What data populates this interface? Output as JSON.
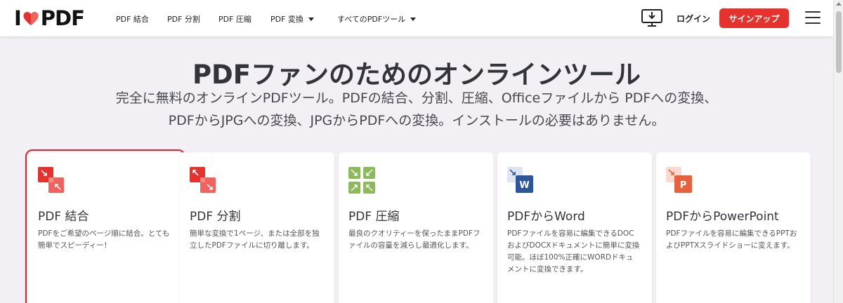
{
  "header": {
    "logo_text_left": "I",
    "logo_text_right": "PDF",
    "nav": [
      {
        "label": "PDF 結合"
      },
      {
        "label": "PDF 分割"
      },
      {
        "label": "PDF 圧縮"
      },
      {
        "label": "PDF 変換"
      },
      {
        "label": "すべてのPDFツール"
      }
    ],
    "login_label": "ログイン",
    "signup_label": "サインアップ"
  },
  "hero": {
    "title": "PDFファンのためのオンラインツール",
    "subtitle_line1": "完全に無料のオンラインPDFツール。PDFの結合、分割、圧縮、Officeファイルから PDFへの変換、",
    "subtitle_line2": "PDFからJPGへの変換、JPGからPDFへの変換。インストールの必要はありません。"
  },
  "tools": [
    {
      "title": "PDF 結合",
      "desc": "PDFをご希望のページ順に結合。とても簡単でスピーディー！",
      "icon": "merge-icon"
    },
    {
      "title": "PDF 分割",
      "desc": "簡単な変換で1ページ、または全部を独立したPDFファイルに切り離します。",
      "icon": "split-icon"
    },
    {
      "title": "PDF 圧縮",
      "desc": "最良のクオリティーを保ったままPDFファイルの容量を減らし最適化します。",
      "icon": "compress-icon"
    },
    {
      "title": "PDFからWord",
      "desc": "PDFファイルを容易に編集できるDOCおよびDOCXドキュメントに簡単に変換可能。ほぼ100%正確にWORDドキュメントに変換できます。",
      "icon": "word-icon"
    },
    {
      "title": "PDFからPowerPoint",
      "desc": "PDFファイルを容易に編集できるPPTおよびPPTXスライドショーに変えます。",
      "icon": "powerpoint-icon"
    }
  ],
  "colors": {
    "brand_red": "#e5322d",
    "compress_green": "#8cb95a",
    "word_blue": "#2b579a",
    "ppt_orange": "#e8613f"
  }
}
